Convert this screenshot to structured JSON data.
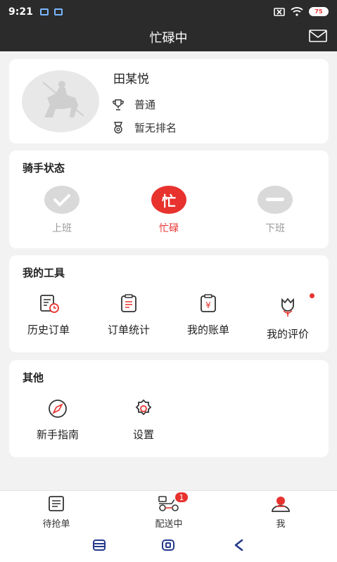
{
  "status_bar": {
    "time": "9:21",
    "battery": "75"
  },
  "header": {
    "title": "忙碌中"
  },
  "profile": {
    "name": "田某悦",
    "level": "普通",
    "ranking": "暂无排名"
  },
  "rider_status": {
    "title": "骑手状态",
    "states": [
      {
        "label": "上班",
        "active": false
      },
      {
        "label": "忙碌",
        "active": true,
        "glyph": "忙"
      },
      {
        "label": "下班",
        "active": false
      }
    ]
  },
  "tools": {
    "title": "我的工具",
    "items": [
      {
        "label": "历史订单",
        "icon": "history-order-icon"
      },
      {
        "label": "订单统计",
        "icon": "order-stats-icon"
      },
      {
        "label": "我的账单",
        "icon": "bill-icon",
        "symbol": "¥"
      },
      {
        "label": "我的评价",
        "icon": "review-icon",
        "dot": true
      }
    ]
  },
  "other": {
    "title": "其他",
    "items": [
      {
        "label": "新手指南",
        "icon": "compass-icon"
      },
      {
        "label": "设置",
        "icon": "settings-gear-icon"
      }
    ]
  },
  "tabbar": {
    "tabs": [
      {
        "label": "待抢单",
        "icon": "order-list-icon"
      },
      {
        "label": "配送中",
        "icon": "delivery-scooter-icon",
        "badge": "1"
      },
      {
        "label": "我",
        "icon": "user-icon"
      }
    ]
  },
  "colors": {
    "accent": "#e8322e",
    "dark_bar": "#2b2b2b",
    "inactive": "#d9d9d9",
    "background": "#f2f2f2"
  }
}
